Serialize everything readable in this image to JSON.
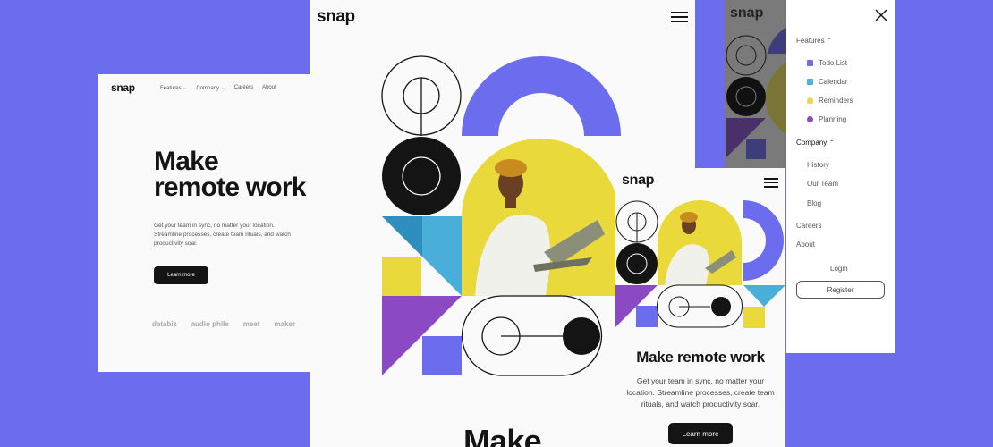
{
  "brand": "snap",
  "colors": {
    "background": "#6c6cef",
    "yellow": "#e9d93a",
    "blue": "#4aaedb",
    "purple": "#8b4ac3",
    "indigo": "#6c6cef",
    "dark": "#141414"
  },
  "desktop": {
    "nav": [
      "Features ⌄",
      "Company ⌄",
      "Careers",
      "About"
    ],
    "headline_line1": "Make",
    "headline_line2": "remote work",
    "subtext": "Get your team in sync, no matter your location. Streamline processes, create team rituals, and watch productivity soar.",
    "cta": "Learn more",
    "clients": [
      "databiz",
      "audio phile",
      "meet",
      "maker"
    ]
  },
  "tablet": {
    "headline_partial": "Make",
    "menu_icon": "hamburger-icon"
  },
  "mobile": {
    "headline": "Make remote work",
    "subtext": "Get your team in sync, no matter your location. Streamline processes, create team rituals, and watch productivity soar.",
    "cta": "Learn more"
  },
  "menu": {
    "features": "Features",
    "feature_items": [
      {
        "label": "Todo List",
        "icon": "todo-icon"
      },
      {
        "label": "Calendar",
        "icon": "calendar-icon"
      },
      {
        "label": "Reminders",
        "icon": "reminders-icon"
      },
      {
        "label": "Planning",
        "icon": "planning-icon"
      }
    ],
    "company": "Company",
    "company_items": [
      "History",
      "Our Team",
      "Blog"
    ],
    "careers": "Careers",
    "about": "About",
    "login": "Login",
    "register": "Register"
  }
}
